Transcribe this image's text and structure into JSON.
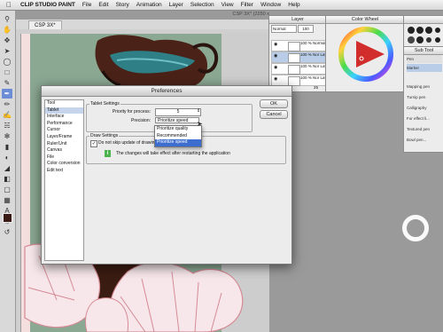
{
  "menubar": {
    "items": [
      "CLIP STUDIO PAINT",
      "File",
      "Edit",
      "Story",
      "Animation",
      "Layer",
      "Selection",
      "View",
      "Filter",
      "Window",
      "Help"
    ]
  },
  "document": {
    "tab_label": "CSP 3X*",
    "window_title": "CSP 3X* (2250 x"
  },
  "layer_panel": {
    "title": "Layer",
    "blend_mode": "Normal",
    "opacity_value": "100",
    "layers": [
      {
        "name": "100 % Normal Folder 2"
      },
      {
        "name": "100 % Nor Layer 37"
      },
      {
        "name": "100 % Nor Layer 36"
      },
      {
        "name": "100 % Nor Layer 34"
      }
    ],
    "footer_value": "25"
  },
  "color_panel": {
    "title": "Color Wheel",
    "accent": "#d22d2d"
  },
  "subtool_panel": {
    "title": "Sub Tool",
    "top_label": "Pen",
    "selected": "Marker",
    "items": [
      "Mapping pen",
      "Turnip pen",
      "Calligraphy",
      "For effect li...",
      "Textured pen",
      "Bowl pen..."
    ]
  },
  "dialog": {
    "title": "Preferences",
    "categories": [
      "Tool",
      "Tablet",
      "Interface",
      "Performance",
      "Cursor",
      "Layer/Frame",
      "Ruler/Unit",
      "Canvas",
      "File",
      "Color conversion",
      "Edit text"
    ],
    "selected_category": "Tablet",
    "tablet_settings": {
      "group_label": "Tablet Settings",
      "priority_label": "Priority for process:",
      "priority_value": "5",
      "precision_label": "Precision:",
      "precision_value": "Prioritize speed",
      "options": [
        "Prioritize quality",
        "Recommended",
        "Prioritize speed"
      ],
      "selected_option": "Prioritize speed"
    },
    "draw_settings": {
      "group_label": "Draw Settings",
      "checkbox_label": "Do not skip update of drawing",
      "checkbox_checked": true,
      "info_text": "The changes will take effect after restarting the application"
    },
    "ok_label": "OK",
    "cancel_label": "Cancel"
  },
  "colors": {
    "canvas_bg": "#8ba893",
    "dialog_bg": "#ececec",
    "selection": "#3d6ecf",
    "info_green": "#4db34d"
  }
}
